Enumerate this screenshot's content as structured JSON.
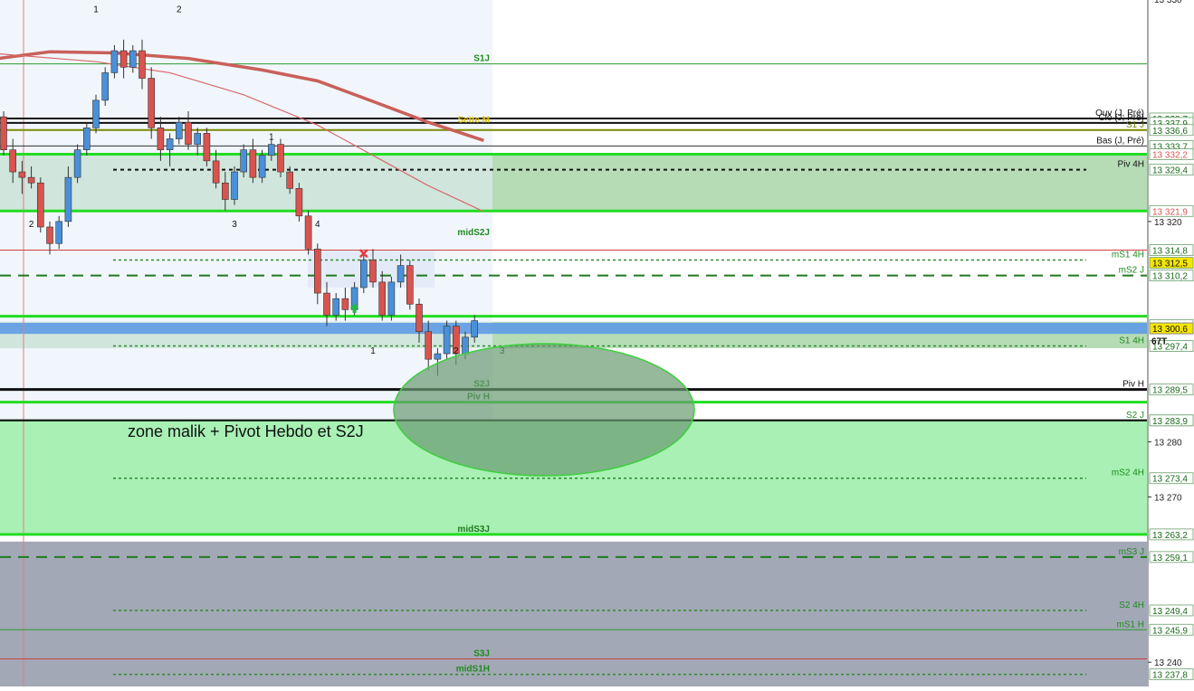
{
  "chart_data": {
    "type": "candlestick",
    "y_axis": {
      "min": 13235.6,
      "max": 13360.2,
      "ticks": [
        13320,
        13280,
        13270,
        13240
      ],
      "top_partial_label": "13 330",
      "position": "right"
    },
    "annotation": {
      "text": "zone malik + Pivot Hebdo et S2J"
    },
    "last_price": 13300.6,
    "volume_tag": "67T",
    "colors": {
      "background": "#ffffff",
      "bull": "#4a90d9",
      "bear": "#d9534f",
      "green_line": "#22dd22",
      "dark_green": "#127812",
      "zone_light_green": "#a8f0b4",
      "zone_mid_green": "#b6dcb6",
      "zone_grey": "#a2a8b6",
      "ellipse_fill": "#6a9a70",
      "ma_thick": "#c9605a",
      "ma_thin": "#d86a6a",
      "last_price_bg": "#f5e600"
    },
    "levels": [
      {
        "label": "S1J",
        "value": 13348.6,
        "style": "thin_green",
        "label_area": "chart"
      },
      {
        "label": "Ouv (J, Pré)",
        "value": 13338.7,
        "style": "black",
        "label_area": "right",
        "tag": "13 338,7"
      },
      {
        "label": "Clô (J, Pré)",
        "value": 13337.9,
        "style": "black",
        "label_area": "right",
        "tag": "13 337,9"
      },
      {
        "label": "Sette M",
        "value": 13337.5,
        "style": "yellow_text",
        "label_area": "chart"
      },
      {
        "label": "S1 J",
        "value": 13336.6,
        "style": "olive",
        "label_area": "right",
        "tag": "13 336,6"
      },
      {
        "label": "Bas (J, Pré)",
        "value": 13333.7,
        "style": "thin_black",
        "label_area": "right",
        "tag": "13 333,7"
      },
      {
        "label": "",
        "value": 13332.2,
        "style": "bright_green",
        "label_area": "none",
        "tag": "13 332,2",
        "tag_color": "#d9534f"
      },
      {
        "label": "Piv 4H",
        "value": 13329.4,
        "style": "dotted_black",
        "label_area": "right",
        "tag": "13 329,4"
      },
      {
        "label": "",
        "value": 13321.9,
        "style": "bright_green",
        "label_area": "none",
        "tag": "13 321,9",
        "tag_color": "#d9534f"
      },
      {
        "label": "midS2J",
        "value": 13317.0,
        "style": "label_only",
        "label_area": "chart"
      },
      {
        "label": "",
        "value": 13314.8,
        "style": "thin_red",
        "label_area": "none",
        "tag": "13 314,8"
      },
      {
        "label": "mS1 4H",
        "value": 13313.0,
        "style": "dotted_green",
        "label_area": "right"
      },
      {
        "label": "",
        "value": 13312.5,
        "style": "none",
        "label_area": "none",
        "tag": "13 312,5",
        "tag_bg": "#f5e600"
      },
      {
        "label": "mS2 J",
        "value": 13310.2,
        "style": "dashed_green",
        "label_area": "right",
        "tag": "13 310,2"
      },
      {
        "label": "",
        "value": 13302.8,
        "style": "bright_green",
        "label_area": "none"
      },
      {
        "label": "",
        "value": 13301.2,
        "style": "none",
        "label_area": "none",
        "tag": "13 301,2"
      },
      {
        "label": "S1 4H",
        "value": 13297.4,
        "style": "dotted_green",
        "label_area": "right",
        "tag": "13 297,4"
      },
      {
        "label": "S2J",
        "value": 13289.5,
        "style": "black_bold",
        "label_area": "chart"
      },
      {
        "label": "Piv H",
        "value": 13289.5,
        "style": "none",
        "label_area": "right",
        "tag": "13 289,5"
      },
      {
        "label": "Piv H",
        "value": 13287.2,
        "style": "bright_green",
        "label_area": "chart"
      },
      {
        "label": "S2 J",
        "value": 13283.9,
        "style": "dark_green",
        "label_area": "right",
        "tag": "13 283,9"
      },
      {
        "label": "",
        "value": 13283.9,
        "style": "black",
        "label_area": "none",
        "tag": "13 283,9"
      },
      {
        "label": "mS2 4H",
        "value": 13273.4,
        "style": "dotted_green",
        "label_area": "right",
        "tag": "13 273,4"
      },
      {
        "label": "midS3J",
        "value": 13263.2,
        "style": "bright_green",
        "label_area": "chart",
        "tag": "13 263,2"
      },
      {
        "label": "mS3 J",
        "value": 13259.1,
        "style": "dashed_green",
        "label_area": "right",
        "tag": "13 259,1"
      },
      {
        "label": "S2 4H",
        "value": 13249.4,
        "style": "dotted_green",
        "label_area": "right",
        "tag": "13 249,4"
      },
      {
        "label": "mS1 H",
        "value": 13245.9,
        "style": "thin_green",
        "label_area": "right",
        "tag": "13 245,9"
      },
      {
        "label": "S3J",
        "value": 13240.6,
        "style": "thin_red",
        "label_area": "chart"
      },
      {
        "label": "midS1H",
        "value": 13237.8,
        "style": "dotted_green",
        "label_area": "chart",
        "tag": "13 237,8"
      }
    ],
    "wave_labels": [
      {
        "text": "1",
        "i": 10,
        "y": 13358.0,
        "color": "#111"
      },
      {
        "text": "2",
        "i": 19,
        "y": 13358.0,
        "color": "#111"
      },
      {
        "text": "2",
        "i": 3,
        "y": 13319.0,
        "color": "#111"
      },
      {
        "text": "1",
        "i": 29,
        "y": 13334.8,
        "color": "#111"
      },
      {
        "text": "3",
        "i": 25,
        "y": 13319.0,
        "color": "#111"
      },
      {
        "text": "4",
        "i": 34,
        "y": 13319.0,
        "color": "#111"
      },
      {
        "text": "1",
        "i": 40,
        "y": 13296.0,
        "color": "#111"
      },
      {
        "text": "2",
        "i": 49,
        "y": 13296.0,
        "color": "#111"
      },
      {
        "text": "3",
        "i": 54,
        "y": 13296.0,
        "color": "#111"
      }
    ],
    "candles": [
      [
        13339,
        13340,
        13332,
        13333
      ],
      [
        13333,
        13335,
        13327,
        13329
      ],
      [
        13329,
        13331,
        13325,
        13328
      ],
      [
        13328,
        13330,
        13326,
        13327
      ],
      [
        13327,
        13328,
        13318,
        13319
      ],
      [
        13319,
        13320,
        13314,
        13316
      ],
      [
        13316,
        13321,
        13315,
        13320
      ],
      [
        13320,
        13330,
        13319,
        13328
      ],
      [
        13328,
        13334,
        13327,
        13333
      ],
      [
        13333,
        13338,
        13332,
        13337
      ],
      [
        13337,
        13343,
        13336,
        13342
      ],
      [
        13342,
        13348,
        13341,
        13347
      ],
      [
        13347,
        13352,
        13346,
        13351
      ],
      [
        13351,
        13353,
        13346,
        13348
      ],
      [
        13348,
        13352,
        13347,
        13351
      ],
      [
        13351,
        13353,
        13344,
        13346
      ],
      [
        13346,
        13348,
        13335,
        13337
      ],
      [
        13337,
        13339,
        13331,
        13333
      ],
      [
        13333,
        13336,
        13330,
        13335
      ],
      [
        13335,
        13339,
        13334,
        13338
      ],
      [
        13338,
        13340,
        13333,
        13334
      ],
      [
        13334,
        13337,
        13332,
        13336
      ],
      [
        13336,
        13337,
        13330,
        13331
      ],
      [
        13331,
        13333,
        13326,
        13327
      ],
      [
        13327,
        13329,
        13322,
        13324
      ],
      [
        13324,
        13330,
        13323,
        13329
      ],
      [
        13329,
        13334,
        13328,
        13333
      ],
      [
        13333,
        13335,
        13327,
        13328
      ],
      [
        13328,
        13333,
        13327,
        13332
      ],
      [
        13332,
        13335,
        13331,
        13334
      ],
      [
        13334,
        13335,
        13328,
        13329
      ],
      [
        13329,
        13330,
        13325,
        13326
      ],
      [
        13326,
        13327,
        13320,
        13321
      ],
      [
        13321,
        13322,
        13314,
        13315
      ],
      [
        13315,
        13316,
        13305,
        13307
      ],
      [
        13307,
        13309,
        13301,
        13303
      ],
      [
        13303,
        13307,
        13302,
        13306
      ],
      [
        13306,
        13308,
        13302,
        13304
      ],
      [
        13304,
        13309,
        13303,
        13308
      ],
      [
        13308,
        13314,
        13307,
        13313
      ],
      [
        13313,
        13315,
        13308,
        13309
      ],
      [
        13309,
        13311,
        13302,
        13303
      ],
      [
        13303,
        13310,
        13302,
        13309
      ],
      [
        13309,
        13314,
        13308,
        13312
      ],
      [
        13312,
        13313,
        13304,
        13305
      ],
      [
        13305,
        13306,
        13298,
        13300
      ],
      [
        13300,
        13302,
        13293,
        13295
      ],
      [
        13295,
        13297,
        13292,
        13296
      ],
      [
        13296,
        13302,
        13295,
        13301
      ],
      [
        13301,
        13302,
        13294,
        13296
      ],
      [
        13296,
        13300,
        13295,
        13299
      ],
      [
        13299,
        13303,
        13298,
        13302
      ]
    ],
    "ma_thick": [
      [
        -1,
        13349.5
      ],
      [
        5,
        13350.8
      ],
      [
        12,
        13350.6
      ],
      [
        20,
        13349.6
      ],
      [
        28,
        13347.5
      ],
      [
        34,
        13345.5
      ],
      [
        40,
        13341.8
      ],
      [
        46,
        13338.0
      ],
      [
        52,
        13334.7
      ]
    ],
    "ma_thin": [
      [
        -1,
        13350.5
      ],
      [
        10,
        13349.0
      ],
      [
        18,
        13347.0
      ],
      [
        26,
        13343.0
      ],
      [
        34,
        13337.5
      ],
      [
        40,
        13332.0
      ],
      [
        46,
        13326.5
      ],
      [
        52,
        13321.8
      ]
    ]
  }
}
